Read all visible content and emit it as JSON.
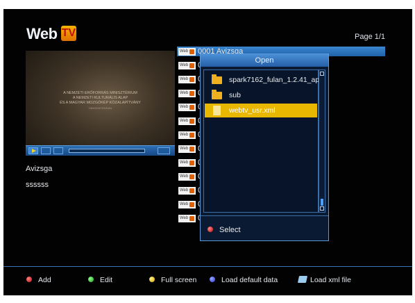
{
  "header": {
    "logo_text": "Web",
    "logo_badge": "TV",
    "page_label": "Page 1/1"
  },
  "preview": {
    "credits": [
      "A NEMZETI ERŐFORRÁS MINISZTÉRIUM",
      "A NEMZETI KULTURÁLIS ALAP",
      "ÉS A MAGYAR MOZGÓKÉP KÖZALAPÍTVÁNY",
      "TÁMOGATÁSÁVAL"
    ],
    "progress": 0.0,
    "title": "Avizsga",
    "description": "ssssss"
  },
  "list": {
    "rows": [
      {
        "badge": "Web",
        "text": "0001  Avizsga",
        "selected": true
      },
      {
        "badge": "Web",
        "text": "0",
        "selected": false
      },
      {
        "badge": "Web",
        "text": "0",
        "selected": false
      },
      {
        "badge": "Web",
        "text": "0",
        "selected": false
      },
      {
        "badge": "Web",
        "text": "0",
        "selected": false
      },
      {
        "badge": "Web",
        "text": "0",
        "selected": false
      },
      {
        "badge": "Web",
        "text": "0",
        "selected": false
      },
      {
        "badge": "Web",
        "text": "0",
        "selected": false
      },
      {
        "badge": "Web",
        "text": "0",
        "selected": false
      },
      {
        "badge": "Web",
        "text": "0",
        "selected": false
      },
      {
        "badge": "Web",
        "text": "0",
        "selected": false
      },
      {
        "badge": "Web",
        "text": "0",
        "selected": false
      },
      {
        "badge": "Web",
        "text": "0",
        "selected": false
      }
    ]
  },
  "dialog": {
    "title": "Open",
    "files": [
      {
        "name": "spark7162_fulan_1.2.41_app",
        "icon": "folder-icon",
        "selected": false
      },
      {
        "name": "sub",
        "icon": "folder-icon",
        "selected": false
      },
      {
        "name": "webtv_usr.xml",
        "icon": "file-icon",
        "selected": true
      }
    ],
    "footer": {
      "color": "#c01010",
      "label": "Select"
    }
  },
  "legend": {
    "add": "Add",
    "edit": "Edit",
    "fullscreen": "Full screen",
    "load_default": "Load default data",
    "load_xml": "Load xml file"
  }
}
